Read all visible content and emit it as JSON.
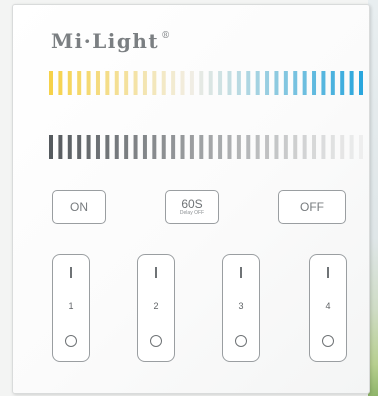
{
  "brand": {
    "name": "Mi·Light",
    "mark": "®"
  },
  "cct_bar": {
    "segments": 34,
    "warm_color": "#f6d24a",
    "mid_color": "#f2eee4",
    "cool_color": "#2aa6dd"
  },
  "brightness_bar": {
    "segments": 34,
    "dark_color": "#555a5e",
    "light_color": "#eeeeee"
  },
  "buttons": {
    "on_label": "ON",
    "timer_label": "60S",
    "timer_sub": "Delay OFF",
    "off_label": "OFF"
  },
  "zones": [
    {
      "on_symbol": "I",
      "number": "1",
      "off_symbol": "O"
    },
    {
      "on_symbol": "I",
      "number": "2",
      "off_symbol": "O"
    },
    {
      "on_symbol": "I",
      "number": "3",
      "off_symbol": "O"
    },
    {
      "on_symbol": "I",
      "number": "4",
      "off_symbol": "O"
    }
  ]
}
